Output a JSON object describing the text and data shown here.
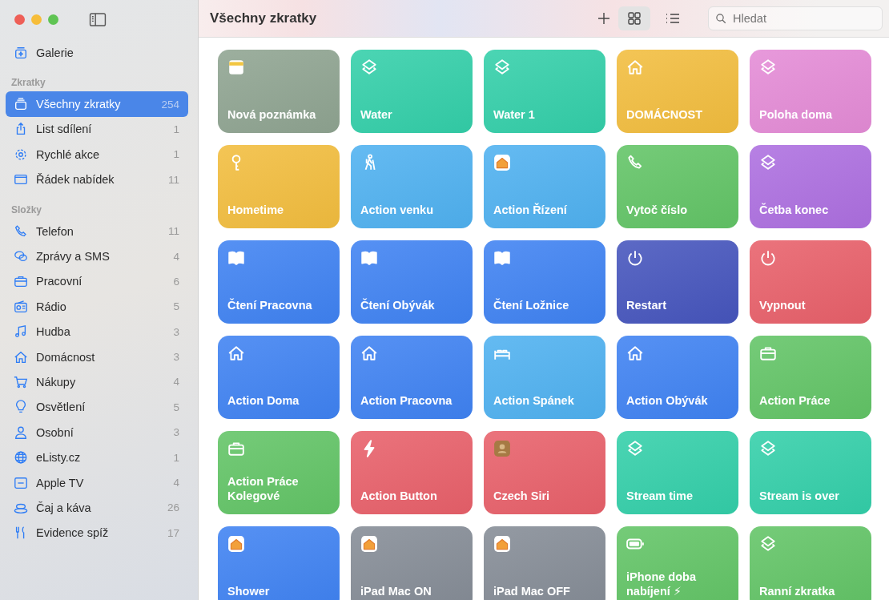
{
  "sidebar": {
    "top_item": {
      "label": "Galerie"
    },
    "sections": [
      {
        "title": "Zkratky",
        "items": [
          {
            "label": "Všechny zkratky",
            "count": "254",
            "selected": true
          },
          {
            "label": "List sdílení",
            "count": "1",
            "selected": false
          },
          {
            "label": "Rychlé akce",
            "count": "1",
            "selected": false
          },
          {
            "label": "Řádek nabídek",
            "count": "11",
            "selected": false
          }
        ]
      },
      {
        "title": "Složky",
        "items": [
          {
            "label": "Telefon",
            "count": "11",
            "selected": false
          },
          {
            "label": "Zprávy a SMS",
            "count": "4",
            "selected": false
          },
          {
            "label": "Pracovní",
            "count": "6",
            "selected": false
          },
          {
            "label": "Rádio",
            "count": "5",
            "selected": false
          },
          {
            "label": "Hudba",
            "count": "3",
            "selected": false
          },
          {
            "label": "Domácnost",
            "count": "3",
            "selected": false
          },
          {
            "label": "Nákupy",
            "count": "4",
            "selected": false
          },
          {
            "label": "Osvětlení",
            "count": "5",
            "selected": false
          },
          {
            "label": "Osobní",
            "count": "3",
            "selected": false
          },
          {
            "label": "eListy.cz",
            "count": "1",
            "selected": false
          },
          {
            "label": "Apple TV",
            "count": "4",
            "selected": false
          },
          {
            "label": "Čaj a káva",
            "count": "26",
            "selected": false
          },
          {
            "label": "Evidence spíž",
            "count": "17",
            "selected": false
          }
        ]
      }
    ]
  },
  "toolbar": {
    "title": "Všechny zkratky",
    "view_buttons": [
      {
        "selected": true
      },
      {
        "selected": false
      }
    ],
    "search": {
      "placeholder": "Hledat"
    }
  },
  "shortcuts": [
    {
      "title": "Nová poznámka",
      "color": "#8fa491"
    },
    {
      "title": "Water",
      "color": "#33cfa9"
    },
    {
      "title": "Water 1",
      "color": "#33cfa9"
    },
    {
      "title": "DOMÁCNOST",
      "color": "#f2bd3e"
    },
    {
      "title": "Poloha doma",
      "color": "#e48bd6"
    },
    {
      "title": "Hometime",
      "color": "#f2bd3e"
    },
    {
      "title": "Action venku",
      "color": "#4fb1f0"
    },
    {
      "title": "Action Řízení",
      "color": "#4fb1f0"
    },
    {
      "title": "Vytoč číslo",
      "color": "#62c466"
    },
    {
      "title": "Četba konec",
      "color": "#ad6fe0"
    },
    {
      "title": "Čtení Pracovna",
      "color": "#3f82f2"
    },
    {
      "title": "Čtení Obývák",
      "color": "#3f82f2"
    },
    {
      "title": "Čtení Ložnice",
      "color": "#3f82f2"
    },
    {
      "title": "Restart",
      "color": "#4655bd"
    },
    {
      "title": "Vypnout",
      "color": "#e8606a"
    },
    {
      "title": "Action Doma",
      "color": "#3f82f2"
    },
    {
      "title": "Action Pracovna",
      "color": "#3f82f2"
    },
    {
      "title": "Action Spánek",
      "color": "#4fb1f0"
    },
    {
      "title": "Action Obývák",
      "color": "#3f82f2"
    },
    {
      "title": "Action Práce",
      "color": "#62c466"
    },
    {
      "title": "Action Práce Kolegové",
      "color": "#62c466"
    },
    {
      "title": "Action Button",
      "color": "#e8606a"
    },
    {
      "title": "Czech Siri",
      "color": "#e8606a"
    },
    {
      "title": "Stream time",
      "color": "#33cfa9"
    },
    {
      "title": "Stream is over",
      "color": "#33cfa9"
    },
    {
      "title": "Shower",
      "color": "#3f82f2"
    },
    {
      "title": "iPad Mac ON",
      "color": "#858c96"
    },
    {
      "title": "iPad Mac OFF",
      "color": "#858c96"
    },
    {
      "title": "iPhone doba nabíjení ⚡",
      "color": "#62c466"
    },
    {
      "title": "Ranní zkratka",
      "color": "#62c466"
    }
  ]
}
